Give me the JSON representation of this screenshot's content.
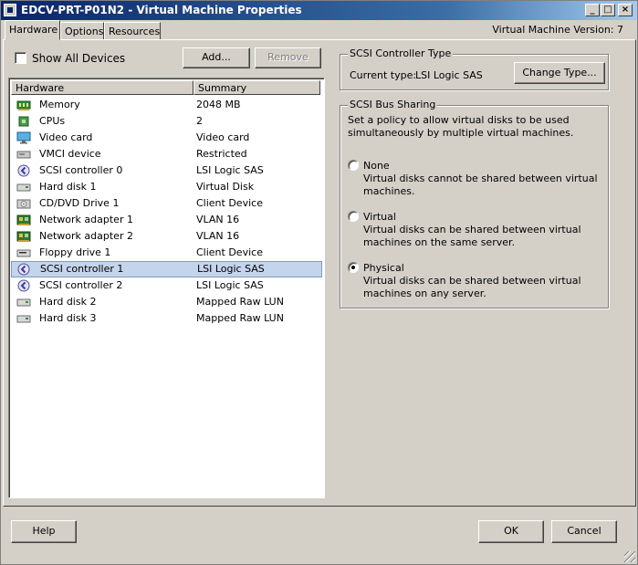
{
  "window": {
    "title": "EDCV-PRT-P01N2 - Virtual Machine Properties",
    "version_label": "Virtual Machine Version: 7"
  },
  "titlebar_buttons": {
    "minimize": "_",
    "maximize": "□",
    "close": "×"
  },
  "tabs": [
    {
      "label": "Hardware",
      "active": true
    },
    {
      "label": "Options",
      "active": false
    },
    {
      "label": "Resources",
      "active": false
    }
  ],
  "hardware_panel": {
    "show_all_devices_label": "Show All Devices",
    "show_all_devices_checked": false,
    "add_button": "Add...",
    "remove_button": "Remove",
    "columns": {
      "hardware": "Hardware",
      "summary": "Summary"
    },
    "items": [
      {
        "name": "Memory",
        "summary": "2048 MB",
        "icon": "memory-icon"
      },
      {
        "name": "CPUs",
        "summary": "2",
        "icon": "cpu-icon"
      },
      {
        "name": "Video card",
        "summary": "Video card",
        "icon": "monitor-icon"
      },
      {
        "name": "VMCI device",
        "summary": "Restricted",
        "icon": "device-icon"
      },
      {
        "name": "SCSI controller 0",
        "summary": "LSI Logic SAS",
        "icon": "scsi-controller-icon"
      },
      {
        "name": "Hard disk 1",
        "summary": "Virtual Disk",
        "icon": "hard-disk-icon"
      },
      {
        "name": "CD/DVD Drive 1",
        "summary": "Client Device",
        "icon": "cd-drive-icon"
      },
      {
        "name": "Network adapter 1",
        "summary": "VLAN 16",
        "icon": "network-adapter-icon"
      },
      {
        "name": "Network adapter 2",
        "summary": "VLAN 16",
        "icon": "network-adapter-icon"
      },
      {
        "name": "Floppy drive 1",
        "summary": "Client Device",
        "icon": "floppy-drive-icon"
      },
      {
        "name": "SCSI controller 1",
        "summary": "LSI Logic SAS",
        "icon": "scsi-controller-icon",
        "selected": true
      },
      {
        "name": "SCSI controller 2",
        "summary": "LSI Logic SAS",
        "icon": "scsi-controller-icon"
      },
      {
        "name": "Hard disk 2",
        "summary": "Mapped Raw LUN",
        "icon": "hard-disk-icon"
      },
      {
        "name": "Hard disk 3",
        "summary": "Mapped Raw LUN",
        "icon": "hard-disk-icon"
      }
    ]
  },
  "scsi_type": {
    "legend": "SCSI Controller Type",
    "current_label": "Current type:",
    "current_value": "LSI Logic SAS",
    "change_button": "Change Type..."
  },
  "bus_sharing": {
    "legend": "SCSI Bus Sharing",
    "description": "Set a policy to allow virtual disks to be used simultaneously by multiple virtual machines.",
    "options": [
      {
        "label": "None",
        "desc": "Virtual disks cannot be shared between virtual machines.",
        "checked": false
      },
      {
        "label": "Virtual",
        "desc": "Virtual disks can be shared between virtual machines on the same server.",
        "checked": false
      },
      {
        "label": "Physical",
        "desc": "Virtual disks can be shared between virtual machines on any server.",
        "checked": true
      }
    ]
  },
  "footer": {
    "help": "Help",
    "ok": "OK",
    "cancel": "Cancel"
  }
}
